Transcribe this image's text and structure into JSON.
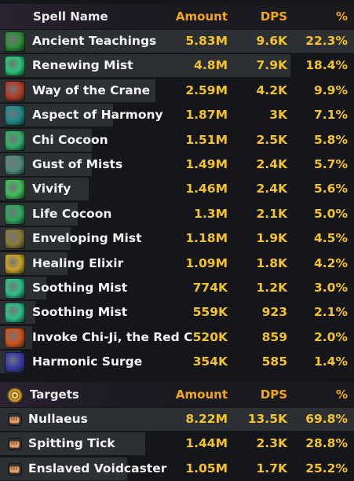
{
  "spells": {
    "header": {
      "name": "Spell Name",
      "amount": "Amount",
      "dps": "DPS",
      "pct": "%"
    },
    "rows": [
      {
        "name": "Ancient Teachings",
        "amount": "5.83M",
        "dps": "9.6K",
        "pct": "22.3%",
        "share": 1.0,
        "icon": "ancient-teachings-icon",
        "color": "#2f8f3a"
      },
      {
        "name": "Renewing Mist",
        "amount": "4.8M",
        "dps": "7.9K",
        "pct": "18.4%",
        "share": 0.82,
        "icon": "renewing-mist-icon",
        "color": "#2bc47a"
      },
      {
        "name": "Way of the Crane",
        "amount": "2.59M",
        "dps": "4.2K",
        "pct": "9.9%",
        "share": 0.44,
        "icon": "way-of-the-crane-icon",
        "color": "#b0402a"
      },
      {
        "name": "Aspect of Harmony",
        "amount": "1.87M",
        "dps": "3K",
        "pct": "7.1%",
        "share": 0.32,
        "icon": "aspect-of-harmony-icon",
        "color": "#1f8a8a"
      },
      {
        "name": "Chi Cocoon",
        "amount": "1.51M",
        "dps": "2.5K",
        "pct": "5.8%",
        "share": 0.26,
        "icon": "chi-cocoon-icon",
        "color": "#34b06a"
      },
      {
        "name": "Gust of Mists",
        "amount": "1.49M",
        "dps": "2.4K",
        "pct": "5.7%",
        "share": 0.26,
        "icon": "gust-of-mists-icon",
        "color": "#4e8a7a"
      },
      {
        "name": "Vivify",
        "amount": "1.46M",
        "dps": "2.4K",
        "pct": "5.6%",
        "share": 0.25,
        "icon": "vivify-icon",
        "color": "#3fbf5a"
      },
      {
        "name": "Life Cocoon",
        "amount": "1.3M",
        "dps": "2.1K",
        "pct": "5.0%",
        "share": 0.22,
        "icon": "life-cocoon-icon",
        "color": "#2fa85f"
      },
      {
        "name": "Enveloping Mist",
        "amount": "1.18M",
        "dps": "1.9K",
        "pct": "4.5%",
        "share": 0.2,
        "icon": "enveloping-mist-icon",
        "color": "#8a7a3a"
      },
      {
        "name": "Healing Elixir",
        "amount": "1.09M",
        "dps": "1.8K",
        "pct": "4.2%",
        "share": 0.19,
        "icon": "healing-elixir-icon",
        "color": "#c9a227"
      },
      {
        "name": "Soothing Mist",
        "amount": "774K",
        "dps": "1.2K",
        "pct": "3.0%",
        "share": 0.13,
        "icon": "soothing-mist-icon",
        "color": "#2fbf8a"
      },
      {
        "name": "Soothing Mist",
        "amount": "559K",
        "dps": "923",
        "pct": "2.1%",
        "share": 0.1,
        "icon": "soothing-mist-icon",
        "color": "#2fbf8a"
      },
      {
        "name": "Invoke Chi-Ji, the Red Crane",
        "amount": "520K",
        "dps": "859",
        "pct": "2.0%",
        "share": 0.09,
        "icon": "invoke-chi-ji-icon",
        "color": "#d0541e"
      },
      {
        "name": "Harmonic Surge",
        "amount": "354K",
        "dps": "585",
        "pct": "1.4%",
        "share": 0.06,
        "icon": "harmonic-surge-icon",
        "color": "#3a3aa8"
      }
    ]
  },
  "targets": {
    "header": {
      "name": "Targets",
      "amount": "Amount",
      "dps": "DPS",
      "pct": "%"
    },
    "header_icon": "targets-icon",
    "rows": [
      {
        "name": "Nullaeus",
        "amount": "8.22M",
        "dps": "13.5K",
        "pct": "69.8%",
        "share": 1.0,
        "icon": "fist-icon"
      },
      {
        "name": "Spitting Tick",
        "amount": "1.44M",
        "dps": "2.3K",
        "pct": "28.8%",
        "share": 0.41,
        "icon": "fist-icon"
      },
      {
        "name": "Enslaved Voidcaster",
        "amount": "1.05M",
        "dps": "1.7K",
        "pct": "25.2%",
        "share": 0.36,
        "icon": "fist-icon"
      }
    ]
  }
}
